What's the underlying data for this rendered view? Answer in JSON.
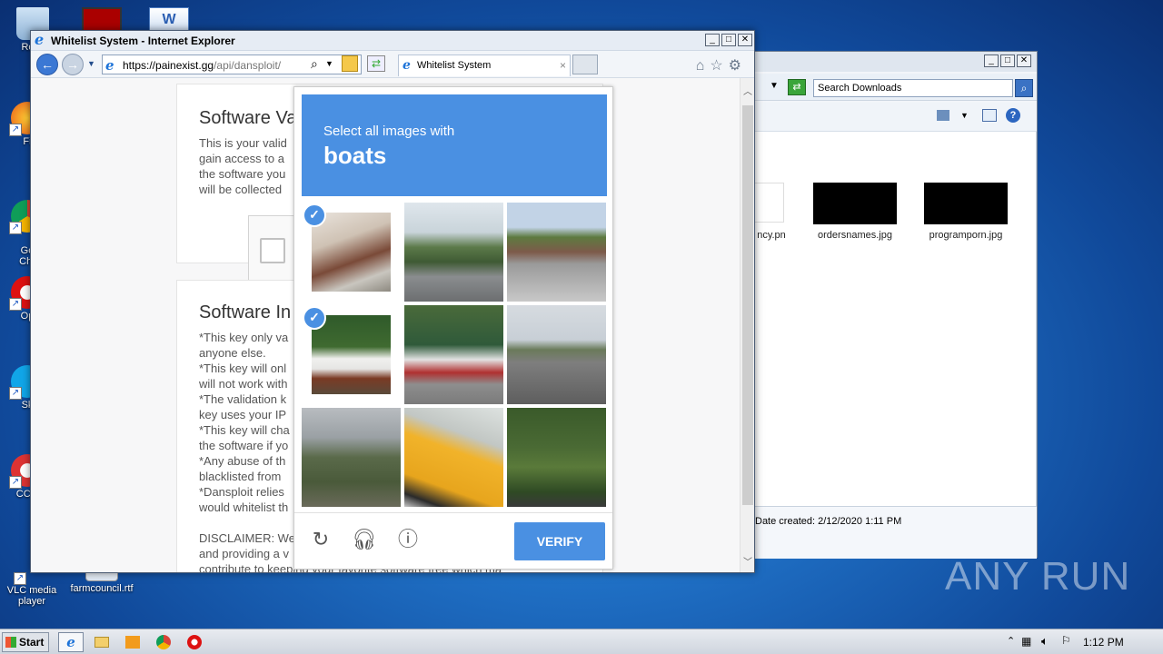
{
  "desktop": {
    "icons": [
      {
        "label": "Recy",
        "name": "recycle-bin-icon"
      },
      {
        "label": "Fi",
        "name": "firefox-icon"
      },
      {
        "label": "Go\nChr",
        "name": "chrome-icon"
      },
      {
        "label": "Op",
        "name": "opera-icon"
      },
      {
        "label": "Sk",
        "name": "skype-icon"
      },
      {
        "label": "CCle",
        "name": "ccleaner-icon"
      },
      {
        "label": "VLC media player",
        "name": "vlc-icon"
      },
      {
        "label": "farmcouncil.rtf",
        "name": "rtf-file-icon"
      }
    ]
  },
  "explorer": {
    "search_placeholder": "Search Downloads",
    "files": [
      {
        "label": "ncy.pn"
      },
      {
        "label": "ordersnames.jpg"
      },
      {
        "label": "programporn.jpg"
      }
    ],
    "status": "Date created: 2/12/2020 1:11 PM"
  },
  "ie": {
    "title": "Whitelist System - Internet Explorer",
    "url_host": "https://painexist.gg",
    "url_path": "/api/dansploit/",
    "tab_label": "Whitelist System",
    "tab_close": "×"
  },
  "page": {
    "card1": {
      "heading": "Software Va",
      "body": "This is your valid\ngain access to a\nthe software you\nwill be collected"
    },
    "card2": {
      "heading": "Software In",
      "body": "*This key only va\nanyone else.\n*This key will onl\nwill not work with\n*The validation k\nkey uses your IP\n*This key will cha\nthe software if yo\n*Any abuse of th\nblacklisted from\n*Dansploit relies\nwould whitelist th\n\nDISCLAIMER: We\nand providing a v\ncontribute to keeping your favorite software free which ma"
    }
  },
  "captcha": {
    "instruction": "Select all images with",
    "object": "boats",
    "tiles": [
      {
        "selected": true,
        "desc": "boat"
      },
      {
        "selected": false,
        "desc": "road"
      },
      {
        "selected": false,
        "desc": "street"
      },
      {
        "selected": true,
        "desc": "boat"
      },
      {
        "selected": false,
        "desc": "boat-trailer"
      },
      {
        "selected": false,
        "desc": "intersection"
      },
      {
        "selected": false,
        "desc": "trees"
      },
      {
        "selected": false,
        "desc": "taxi"
      },
      {
        "selected": false,
        "desc": "trees-pole"
      }
    ],
    "verify_label": "VERIFY"
  },
  "taskbar": {
    "start_label": "Start",
    "clock": "1:12 PM"
  },
  "watermark": "ANY RUN"
}
